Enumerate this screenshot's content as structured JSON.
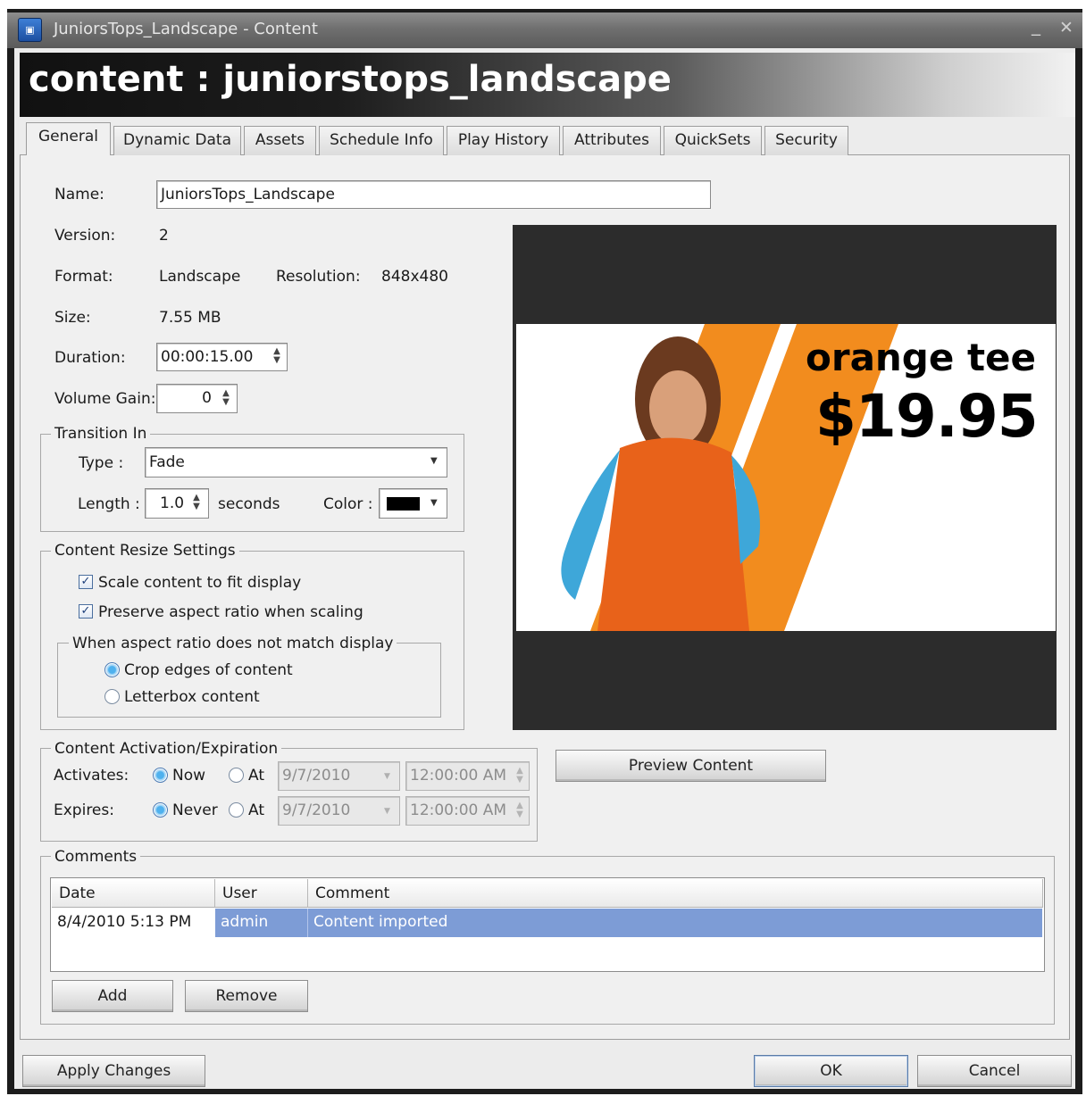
{
  "window": {
    "title": "JuniorsTops_Landscape - Content",
    "minimize": "_",
    "close": "✕",
    "icon": "app-icon"
  },
  "header": {
    "title": "content : juniorstops_landscape"
  },
  "tabs": [
    {
      "label": "General",
      "active": true
    },
    {
      "label": "Dynamic Data"
    },
    {
      "label": "Assets"
    },
    {
      "label": "Schedule Info"
    },
    {
      "label": "Play History"
    },
    {
      "label": "Attributes"
    },
    {
      "label": "QuickSets"
    },
    {
      "label": "Security"
    }
  ],
  "general": {
    "name_label": "Name:",
    "name_value": "JuniorsTops_Landscape",
    "version_label": "Version:",
    "version_value": "2",
    "format_label": "Format:",
    "format_value": "Landscape",
    "resolution_label": "Resolution:",
    "resolution_value": "848x480",
    "size_label": "Size:",
    "size_value": "7.55 MB",
    "duration_label": "Duration:",
    "duration_value": "00:00:15.00",
    "volume_label": "Volume Gain:",
    "volume_value": "0"
  },
  "transition": {
    "legend": "Transition In",
    "type_label": "Type :",
    "type_value": "Fade",
    "length_label": "Length :",
    "length_value": "1.0",
    "seconds_label": "seconds",
    "color_label": "Color :",
    "color_value": "#000000"
  },
  "resize": {
    "legend": "Content Resize Settings",
    "scale_label": "Scale content to fit display",
    "scale_checked": true,
    "preserve_label": "Preserve aspect ratio when scaling",
    "preserve_checked": true,
    "mismatch_legend": "When aspect ratio does not match display",
    "crop_label": "Crop edges of content",
    "crop_selected": true,
    "letterbox_label": "Letterbox content"
  },
  "activation": {
    "legend": "Content Activation/Expiration",
    "activates_label": "Activates:",
    "now_label": "Now",
    "at_label": "At",
    "activate_date": "9/7/2010",
    "activate_time": "12:00:00 AM",
    "expires_label": "Expires:",
    "never_label": "Never",
    "expire_at_label": "At",
    "expire_date": "9/7/2010",
    "expire_time": "12:00:00 AM"
  },
  "preview": {
    "button_label": "Preview Content",
    "headline": "orange tee",
    "price": "$19.95"
  },
  "comments": {
    "legend": "Comments",
    "columns": [
      "Date",
      "User",
      "Comment"
    ],
    "rows": [
      {
        "date": "8/4/2010 5:13 PM",
        "user": "admin",
        "comment": "Content imported"
      }
    ],
    "add_label": "Add",
    "remove_label": "Remove"
  },
  "footer": {
    "apply_label": "Apply Changes",
    "ok_label": "OK",
    "cancel_label": "Cancel"
  }
}
